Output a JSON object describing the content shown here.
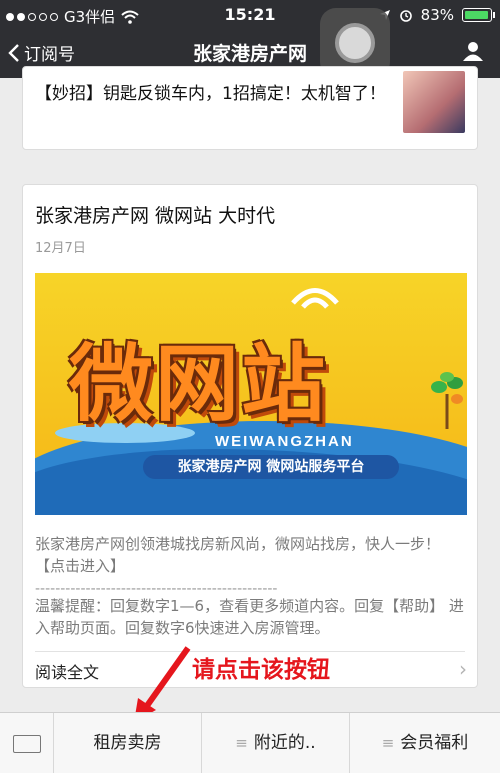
{
  "status": {
    "carrier": "G3伴侣",
    "time": "15:21",
    "battery": "83%"
  },
  "nav": {
    "back_label": "订阅号",
    "title": "张家港房产网"
  },
  "article1": {
    "text": "【妙招】钥匙反锁车内，1招搞定！太机智了！"
  },
  "article2": {
    "title": "张家港房产网 微网站 大时代",
    "date": "12月7日",
    "banner": {
      "logo_text": "微网站",
      "pinyin": "WEIWANGZHAN",
      "subtitle": "张家港房产网 微网站服务平台"
    },
    "desc": "张家港房产网创领港城找房新风尚，微网站找房，快人一步！【点击进入】",
    "dashes": "------------------------------------------------",
    "tip": "温馨提醒：回复数字1—6，查看更多频道内容。回复【帮助】 进入帮助页面。回复数字6快速进入房源管理。",
    "read_all": "阅读全文"
  },
  "annotation": "请点击该按钮",
  "bottom_menu": {
    "items": [
      {
        "label": "租房卖房"
      },
      {
        "label": "附近的.."
      },
      {
        "label": "会员福利"
      }
    ]
  },
  "colors": {
    "nav_bg": "#2e2f33",
    "annotation_red": "#e5161d",
    "banner_yellow": "#f7d428",
    "banner_blue": "#2f86d0"
  }
}
